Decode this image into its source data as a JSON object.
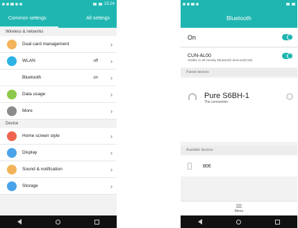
{
  "left": {
    "status_time": "15:24",
    "tabs": [
      "Common settings",
      "All settings"
    ],
    "sections": [
      {
        "header": "Wireless & networks",
        "items": [
          {
            "label": "Dual card management",
            "status": "",
            "icon_color": "#f2b35a",
            "icon": "sim-icon"
          },
          {
            "label": "WLAN",
            "status": "off",
            "icon_color": "#2fb3e6",
            "icon": "wifi-icon"
          },
          {
            "label": "Bluetooth",
            "status": "on",
            "icon_color": "",
            "icon": "bluetooth-icon"
          },
          {
            "label": "Data usage",
            "status": "",
            "icon_color": "#8cc84b",
            "icon": "data-usage-icon"
          },
          {
            "label": "More",
            "status": "",
            "icon_color": "#8b8b8b",
            "icon": "more-icon"
          }
        ]
      },
      {
        "header": "Device",
        "items": [
          {
            "label": "Home screen style",
            "status": "",
            "icon_color": "#f0644f",
            "icon": "home-style-icon"
          },
          {
            "label": "Display",
            "status": "",
            "icon_color": "#4aa3e8",
            "icon": "display-icon"
          },
          {
            "label": "Sound & notification",
            "status": "",
            "icon_color": "#f2b35a",
            "icon": "sound-icon"
          },
          {
            "label": "Storage",
            "status": "",
            "icon_color": "#4aa3e8",
            "icon": "storage-icon"
          }
        ]
      }
    ]
  },
  "right": {
    "title": "Bluetooth",
    "on_label": "On",
    "device_name": "CUN-AL00",
    "visible_text": "Visible to all nearby Bluetooth devices(0:58)",
    "paired_header": "Paired devices",
    "paired_device": {
      "name": "Pure S6BH-1",
      "sub": "The connection"
    },
    "available_header": "Available devices",
    "available_device": {
      "name": "806"
    },
    "menu_label": "Menu"
  },
  "colors": {
    "accent": "#1fb6b1"
  }
}
